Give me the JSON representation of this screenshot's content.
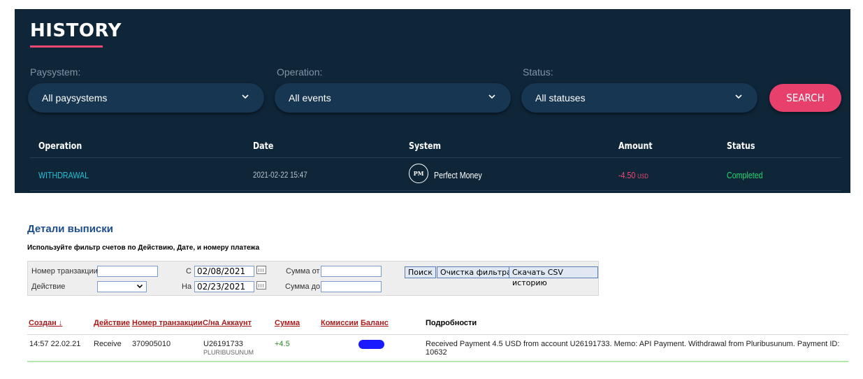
{
  "history": {
    "title": "HISTORY",
    "filters": {
      "paysystem_label": "Paysystem:",
      "paysystem_value": "All paysystems",
      "operation_label": "Operation:",
      "operation_value": "All events",
      "status_label": "Status:",
      "status_value": "All statuses",
      "search_button": "SEARCH"
    },
    "columns": [
      "Operation",
      "Date",
      "System",
      "Amount",
      "Status"
    ],
    "rows": [
      {
        "operation": "WITHDRAWAL",
        "date": "2021-02-22 15:47",
        "system_badge": "PM",
        "system": "Perfect Money",
        "amount": "-4.50",
        "currency": "USD",
        "status": "Completed"
      }
    ],
    "colors": {
      "accent": "#e8406c",
      "operation": "#22c0d4",
      "completed": "#1ed66e",
      "panel": "#0f2639"
    }
  },
  "statement": {
    "title": "Детали выписки",
    "subtitle": "Используйте фильтр счетов по Действию, Дате, и номеру платежа",
    "filter": {
      "txn_label": "Номер транзакции",
      "txn_value": "",
      "action_label": "Действие",
      "action_value": "",
      "from_label": "С",
      "from_value": "02/08/2021",
      "to_label": "На",
      "to_value": "02/23/2021",
      "sum_from_label": "Сумма от",
      "sum_from_value": "",
      "sum_to_label": "Сумма до",
      "sum_to_value": "",
      "search_button": "Поиск",
      "clear_button": "Очистка фильтра",
      "csv_button": "Скачать CSV историю"
    },
    "columns": {
      "created": "Создан ↓",
      "action": "Действие",
      "txn": "Номер транзакции",
      "account": "С/на Аккаунт",
      "amount": "Сумма",
      "fees": "Комиссии",
      "balance": "Баланс",
      "details": "Подробности"
    },
    "rows": [
      {
        "created": "14:57 22.02.21",
        "action": "Receive",
        "txn": "370905010",
        "account": "U26191733",
        "account_name": "PLURIBUSUNUM",
        "amount": "+4.5",
        "details": "Received Payment 4.5 USD from account U26191733. Memo: API Payment. Withdrawal from Pluribusunum. Payment ID: 10632"
      }
    ]
  }
}
